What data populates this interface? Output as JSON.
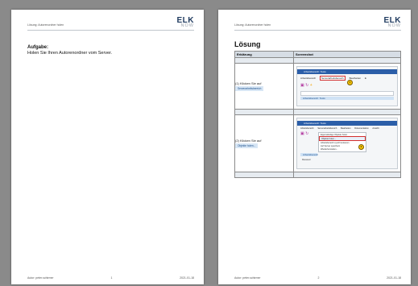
{
  "header": {
    "title": "Lösung: Autorenordner holen",
    "logo_main": "ELK",
    "logo_sub": "NOW"
  },
  "page1": {
    "task_label": "Aufgabe:",
    "task_text": "Holen Sie Ihren Autorenordner vom Server.",
    "footer": {
      "author": "Autor: peter.schirmer",
      "page": "1",
      "date": "2021-01-18"
    }
  },
  "page2": {
    "solution_title": "Lösung",
    "table": {
      "col1": "Erklärung",
      "col2": "Screenshot"
    },
    "steps": [
      {
        "text": "(1) Klicken Sie auf",
        "chip": "Serverarbeitsbereich",
        "shot": {
          "bar": "Arbeitsbereich: Tests",
          "tabs": [
            "Arbeitsbereich",
            "Serverarbeitsbereich",
            "Bearbeiten",
            "E"
          ],
          "list_item": "Arbeitsbereich: Tests",
          "marker": "1"
        }
      },
      {
        "text": "(2) Klicken Sie auf",
        "chip": "Objekte holen...",
        "shot": {
          "bar": "Arbeitsbereich: Tests",
          "tabs": [
            "Arbeitsbereich",
            "Serverarbeitsbereich",
            "Bearbeiten",
            "Dokumentation",
            "Ansicht"
          ],
          "menu": [
            "Eigenständige Objekte holen",
            "Objekte holen...",
            "Arbeitsbereich synchronisieren",
            "Auf Server speichern",
            "Wiederherstellen..."
          ],
          "side": "Arbeitsbereich",
          "side2": "Ressourc",
          "marker": "2"
        }
      }
    ],
    "footer": {
      "author": "Autor: peter.schirmer",
      "page": "2",
      "date": "2021-01-18"
    }
  }
}
